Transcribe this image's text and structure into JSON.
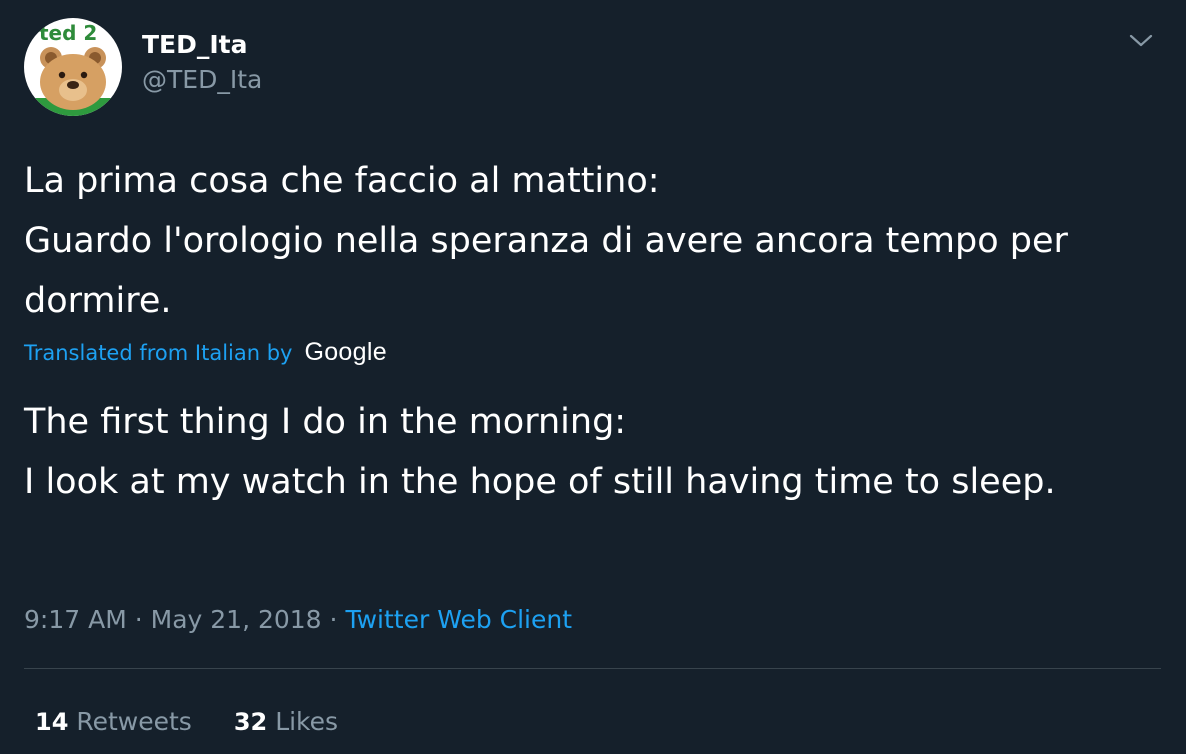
{
  "user": {
    "display_name": "TED_Ita",
    "handle": "@TED_Ita",
    "avatar_logo": "ted 2"
  },
  "tweet": {
    "original_text": "La prima cosa che faccio al mattino:\nGuardo l'orologio nella speranza di avere ancora tempo per dormire.",
    "translation_label": "Translated from Italian by",
    "translation_provider": "Google",
    "translated_text": "The first thing I do in the morning:\n I look at my watch in the hope of still having time to sleep."
  },
  "meta": {
    "time": "9:17 AM",
    "separator": "·",
    "date": "May 21, 2018",
    "source": "Twitter Web Client"
  },
  "stats": {
    "retweets_count": "14",
    "retweets_label": "Retweets",
    "likes_count": "32",
    "likes_label": "Likes"
  },
  "icons": {
    "menu": "chevron-down-icon"
  },
  "colors": {
    "background": "#15202b",
    "link": "#1da1f2",
    "secondary_text": "#8899a6",
    "divider": "#38444d"
  }
}
